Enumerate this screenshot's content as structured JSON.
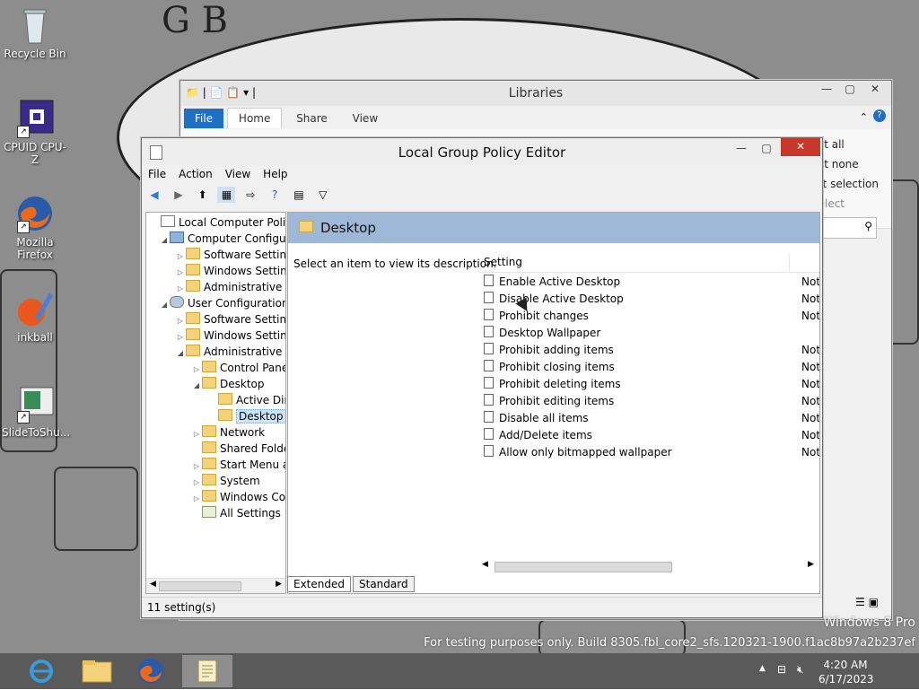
{
  "desktop": {
    "icons": [
      {
        "label": "Recycle Bin",
        "icon": "recycle-bin-icon"
      },
      {
        "label": "CPUID CPU-Z",
        "icon": "cpu-z-icon"
      },
      {
        "label": "Mozilla\nFirefox",
        "icon": "firefox-icon"
      },
      {
        "label": "inkball",
        "icon": "inkball-icon"
      },
      {
        "label": "SlideToShu...",
        "icon": "slide-to-shutdown-icon"
      }
    ],
    "watermark_line1": "Windows 8 Pro",
    "watermark_line2": "For testing purposes only. Build 8305.fbl_core2_sfs.120321-1900.f1ac8b97a2b237ef"
  },
  "libraries": {
    "title": "Libraries",
    "tabs": [
      "File",
      "Home",
      "Share",
      "View"
    ],
    "select_items": [
      "ct all",
      "ct none",
      "rt selection",
      "elect"
    ]
  },
  "gpe": {
    "title": "Local Group Policy Editor",
    "menu": [
      "File",
      "Action",
      "View",
      "Help"
    ],
    "toolbar_icons": [
      "back-icon",
      "forward-icon",
      "up-folder-icon",
      "show-hide-tree-icon",
      "export-list-icon",
      "help-icon",
      "properties-icon",
      "filter-icon"
    ],
    "tree": [
      {
        "label": "Local Computer Policy",
        "level": 0,
        "exp": "",
        "icon": "policy"
      },
      {
        "label": "Computer Configura",
        "level": 1,
        "exp": "open",
        "icon": "computer"
      },
      {
        "label": "Software Settings",
        "level": 2,
        "exp": "closed",
        "icon": "folder"
      },
      {
        "label": "Windows Setting",
        "level": 2,
        "exp": "closed",
        "icon": "folder"
      },
      {
        "label": "Administrative Te",
        "level": 2,
        "exp": "closed",
        "icon": "folder"
      },
      {
        "label": "User Configuration",
        "level": 1,
        "exp": "open",
        "icon": "user"
      },
      {
        "label": "Software Settings",
        "level": 2,
        "exp": "closed",
        "icon": "folder"
      },
      {
        "label": "Windows Setting",
        "level": 2,
        "exp": "closed",
        "icon": "folder"
      },
      {
        "label": "Administrative Te",
        "level": 2,
        "exp": "open",
        "icon": "folder"
      },
      {
        "label": "Control Panel",
        "level": 3,
        "exp": "closed",
        "icon": "folder"
      },
      {
        "label": "Desktop",
        "level": 3,
        "exp": "open",
        "icon": "folder"
      },
      {
        "label": "Active Dir",
        "level": 4,
        "exp": "",
        "icon": "folder"
      },
      {
        "label": "Desktop",
        "level": 4,
        "exp": "",
        "icon": "folder",
        "selected": true
      },
      {
        "label": "Network",
        "level": 3,
        "exp": "closed",
        "icon": "folder"
      },
      {
        "label": "Shared Folder",
        "level": 3,
        "exp": "",
        "icon": "folder"
      },
      {
        "label": "Start Menu ar",
        "level": 3,
        "exp": "closed",
        "icon": "folder"
      },
      {
        "label": "System",
        "level": 3,
        "exp": "closed",
        "icon": "folder"
      },
      {
        "label": "Windows Cor",
        "level": 3,
        "exp": "closed",
        "icon": "folder"
      },
      {
        "label": "All Settings",
        "level": 3,
        "exp": "",
        "icon": "all-settings"
      }
    ],
    "header": "Desktop",
    "description": "Select an item to view its description.",
    "column_setting": "Setting",
    "rows": [
      {
        "name": "Enable Active Desktop",
        "state": "Not"
      },
      {
        "name": "Disable Active Desktop",
        "state": "Not"
      },
      {
        "name": "Prohibit changes",
        "state": "Not"
      },
      {
        "name": "Desktop Wallpaper",
        "state": ""
      },
      {
        "name": "Prohibit adding items",
        "state": "Not"
      },
      {
        "name": "Prohibit closing items",
        "state": "Not"
      },
      {
        "name": "Prohibit deleting items",
        "state": "Not"
      },
      {
        "name": "Prohibit editing items",
        "state": "Not"
      },
      {
        "name": "Disable all items",
        "state": "Not"
      },
      {
        "name": "Add/Delete items",
        "state": "Not"
      },
      {
        "name": "Allow only bitmapped wallpaper",
        "state": "Not"
      }
    ],
    "tab_extended": "Extended",
    "tab_standard": "Standard",
    "status": "11 setting(s)"
  },
  "taskbar": {
    "apps": [
      "internet-explorer-icon",
      "file-explorer-icon",
      "firefox-icon",
      "group-policy-icon"
    ],
    "time": "4:20 AM",
    "date": "6/17/2023",
    "tray_icons": [
      "show-hidden-icons-icon",
      "network-icon",
      "volume-muted-icon"
    ]
  },
  "colors": {
    "accent": "#1f6fc5",
    "header": "#9fb8d7",
    "close": "#c7382b"
  }
}
